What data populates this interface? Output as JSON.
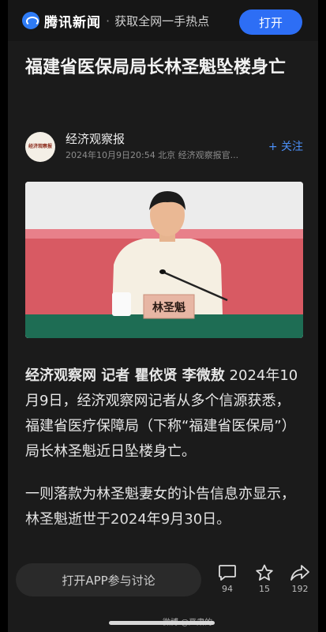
{
  "banner": {
    "brand": "腾讯新闻",
    "separator": "·",
    "slogan": "获取全网一手热点",
    "open_label": "打开"
  },
  "article": {
    "title": "福建省医保局局长林圣魁坠楼身亡",
    "author": {
      "name": "经济观察报",
      "avatar_text": "经济观察报",
      "meta": "2024年10月9日20:54  北京  经济观察报官...",
      "follow_label": "+ 关注"
    },
    "photo": {
      "nameplate": "林圣魁"
    },
    "paragraphs": [
      {
        "byline": "经济观察网 记者 瞿依贤 李微敖",
        "text": " 2024年10月9日，经济观察网记者从多个信源获悉，福建省医疗保障局（下称“福建省医保局”）局长林圣魁近日坠楼身亡。"
      },
      {
        "byline": "",
        "text": "一则落款为林圣魁妻女的讣告信息亦显示，林圣魁逝世于2024年9月30日。"
      }
    ]
  },
  "bottom_bar": {
    "discuss_label": "打开APP参与讨论",
    "comment_count": "94",
    "favorite_count": "15",
    "share_count": "192",
    "watermark": "微博 @严肃的"
  },
  "colors": {
    "accent": "#2d6ef5",
    "background": "#1b1b1b",
    "follow": "#4b8ff7"
  }
}
